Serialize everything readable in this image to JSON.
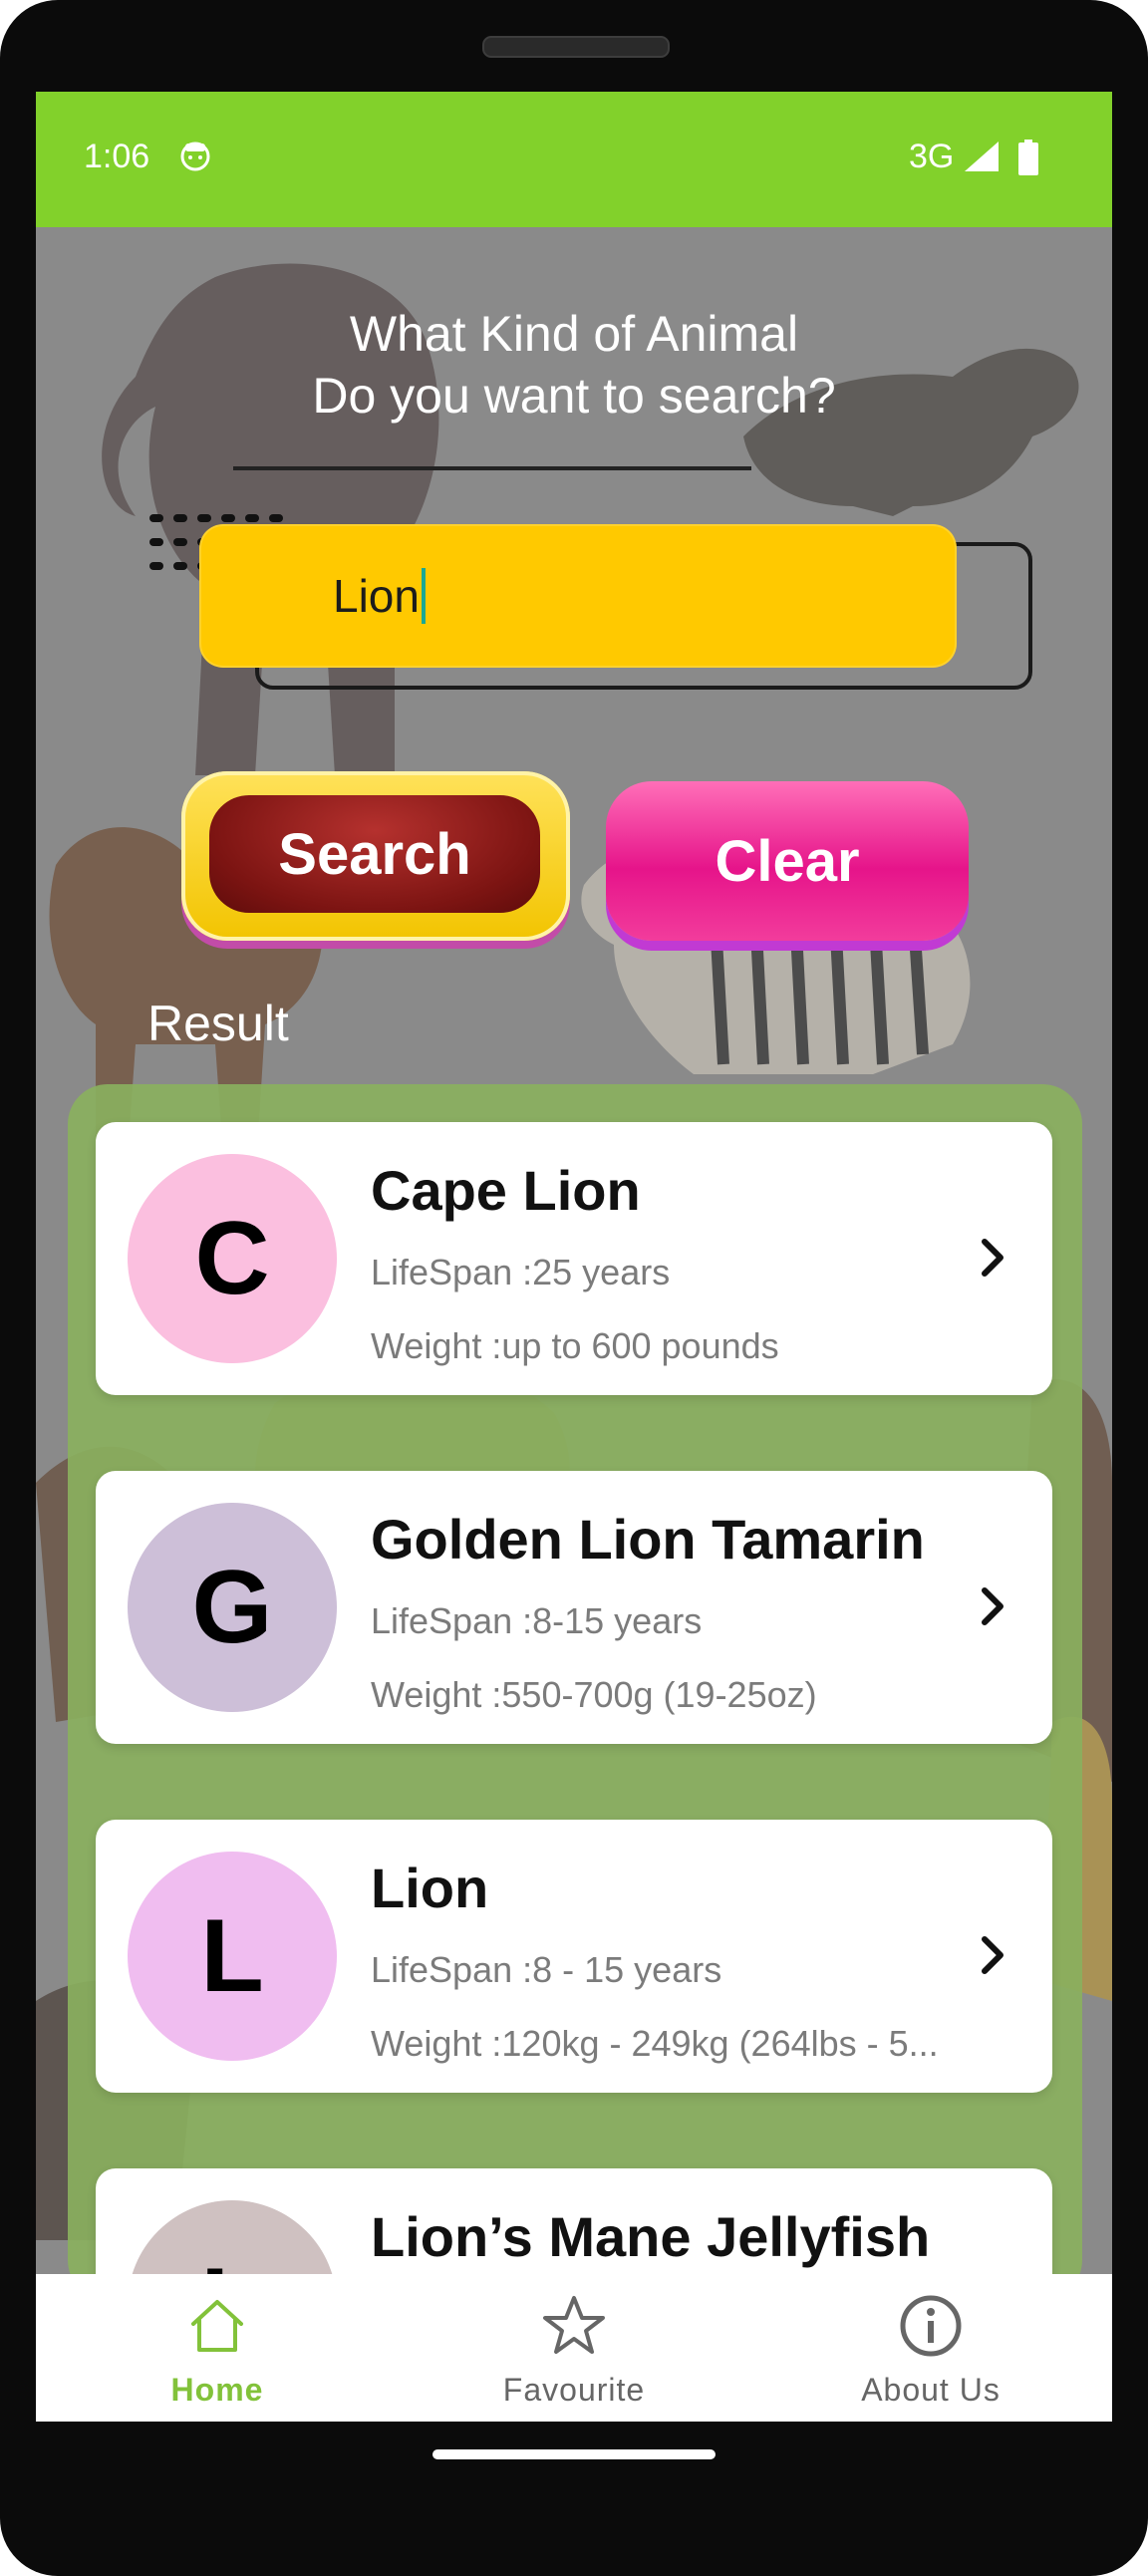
{
  "status": {
    "time": "1:06",
    "network": "3G"
  },
  "search": {
    "heading_line1": "What Kind of Animal",
    "heading_line2": "Do you want to search?",
    "query": "Lion",
    "search_label": "Search",
    "clear_label": "Clear"
  },
  "results": {
    "label": "Result",
    "items": [
      {
        "initial": "C",
        "title": "Cape Lion",
        "lifespan": "LifeSpan :25 years",
        "weight": "Weight :up to 600 pounds",
        "avatar_color": "#fbbfdf"
      },
      {
        "initial": "G",
        "title": "Golden Lion Tamarin",
        "lifespan": "LifeSpan :8-15 years",
        "weight": "Weight :550-700g (19-25oz)",
        "avatar_color": "#cdbfd8"
      },
      {
        "initial": "L",
        "title": "Lion",
        "lifespan": "LifeSpan :8 - 15 years",
        "weight": "Weight :120kg - 249kg (264lbs - 5...",
        "avatar_color": "#f0bdf0"
      },
      {
        "initial": "L",
        "title": "Lion’s Mane Jellyfish",
        "lifespan": "",
        "weight": "",
        "avatar_color": "#cfc1c1"
      }
    ]
  },
  "nav": {
    "home": "Home",
    "favourite": "Favourite",
    "about": "About Us",
    "active_color": "#82c23a"
  },
  "colors": {
    "statusbar": "#82d12b",
    "search_field": "#ffc900",
    "search_button": "#7c1412",
    "clear_button": "#e6148a",
    "results_panel": "#8ab05e"
  },
  "icons": [
    "face-icon",
    "signal-icon",
    "battery-icon",
    "chevron-right-icon",
    "home-icon",
    "star-icon",
    "info-icon"
  ]
}
